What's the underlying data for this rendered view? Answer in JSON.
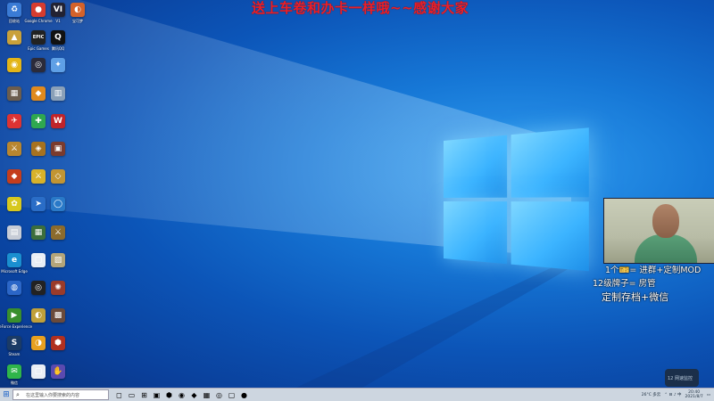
{
  "banner": {
    "text": "送上车卷和办卡一样哦~~感谢大家"
  },
  "desktop_icons": [
    {
      "label": "回收站",
      "color": "#3a7bd5",
      "glyph": "♻"
    },
    {
      "label": "Google Chrome",
      "color": "#d63c2f",
      "glyph": "●"
    },
    {
      "label": "V1",
      "color": "#223",
      "glyph": "VI"
    },
    {
      "label": "宝可梦",
      "color": "#d4622a",
      "glyph": "◐"
    },
    {
      "label": "",
      "color": "#c9a13a",
      "glyph": "▲"
    },
    {
      "label": "Epic Games",
      "color": "#222",
      "glyph": "EPIC"
    },
    {
      "label": "腾讯QQ",
      "color": "#111",
      "glyph": "Q"
    },
    {
      "label": "",
      "color": "#e3b518",
      "glyph": "◉"
    },
    {
      "label": "",
      "color": "#2b2b3a",
      "glyph": "◎"
    },
    {
      "label": "",
      "color": "#5fa0e6",
      "glyph": "✦"
    },
    {
      "label": "",
      "color": "#6b5d4e",
      "glyph": "▦"
    },
    {
      "label": "",
      "color": "#e08a1e",
      "glyph": "◆"
    },
    {
      "label": "",
      "color": "#8aa0b8",
      "glyph": "▥"
    },
    {
      "label": "",
      "color": "#d33",
      "glyph": "✈"
    },
    {
      "label": "",
      "color": "#2fa84f",
      "glyph": "✚"
    },
    {
      "label": "",
      "color": "#c0242a",
      "glyph": "W"
    },
    {
      "label": "",
      "color": "#b8862f",
      "glyph": "⚔"
    },
    {
      "label": "",
      "color": "#a7721f",
      "glyph": "◈"
    },
    {
      "label": "",
      "color": "#7a3b2e",
      "glyph": "▣"
    },
    {
      "label": "",
      "color": "#c53d1d",
      "glyph": "◆"
    },
    {
      "label": "",
      "color": "#d8b22a",
      "glyph": "⚔"
    },
    {
      "label": "",
      "color": "#c29533",
      "glyph": "◇"
    },
    {
      "label": "",
      "color": "#d7c81f",
      "glyph": "✿"
    },
    {
      "label": "",
      "color": "#2a6dc7",
      "glyph": "➤"
    },
    {
      "label": "",
      "color": "#2979c8",
      "glyph": "◯"
    },
    {
      "label": "",
      "color": "#c7ccd6",
      "glyph": "▤"
    },
    {
      "label": "",
      "color": "#3c6e3c",
      "glyph": "▦"
    },
    {
      "label": "",
      "color": "#8b6b2d",
      "glyph": "⚔"
    },
    {
      "label": "Microsoft Edge",
      "color": "#1a8fd0",
      "glyph": "e"
    },
    {
      "label": "",
      "color": "#e9eef5",
      "glyph": "▢"
    },
    {
      "label": "",
      "color": "#b3a57a",
      "glyph": "▨"
    },
    {
      "label": "",
      "color": "#2b66c7",
      "glyph": "◍"
    },
    {
      "label": "",
      "color": "#222",
      "glyph": "◎"
    },
    {
      "label": "",
      "color": "#9a3b2a",
      "glyph": "✺"
    },
    {
      "label": "GeForce Experience",
      "color": "#3a8f2c",
      "glyph": "▶"
    },
    {
      "label": "",
      "color": "#c0a03a",
      "glyph": "◐"
    },
    {
      "label": "",
      "color": "#6a4a3a",
      "glyph": "▩"
    },
    {
      "label": "Steam",
      "color": "#1b3b66",
      "glyph": "S"
    },
    {
      "label": "",
      "color": "#e8a020",
      "glyph": "◑"
    },
    {
      "label": "",
      "color": "#b03020",
      "glyph": "⬢"
    },
    {
      "label": "微信",
      "color": "#2fb54a",
      "glyph": "✉"
    },
    {
      "label": "",
      "color": "#e9eef5",
      "glyph": "▢"
    },
    {
      "label": "",
      "color": "#5a4ab0",
      "glyph": "✋"
    }
  ],
  "overlay": {
    "line1": "1个🎫= 进群+定制MOD",
    "line2": "12级牌子= 房管",
    "line3": "定制存档+微信"
  },
  "tray_widget": {
    "text": "12 网速监控"
  },
  "taskbar": {
    "start_icon": "windows-icon",
    "search_placeholder": "在这里输入你要搜索的内容",
    "apps": [
      "◻",
      "▭",
      "⊞",
      "▣",
      "⬢",
      "◉",
      "◆",
      "▦",
      "◎",
      "▢",
      "●"
    ],
    "weather": "26°C 多云",
    "time": "20:40",
    "date": "2021/8/7"
  },
  "colors": {
    "accent": "#1677d6",
    "banner": "#e8202a",
    "taskbar": "#cdd6e0"
  }
}
